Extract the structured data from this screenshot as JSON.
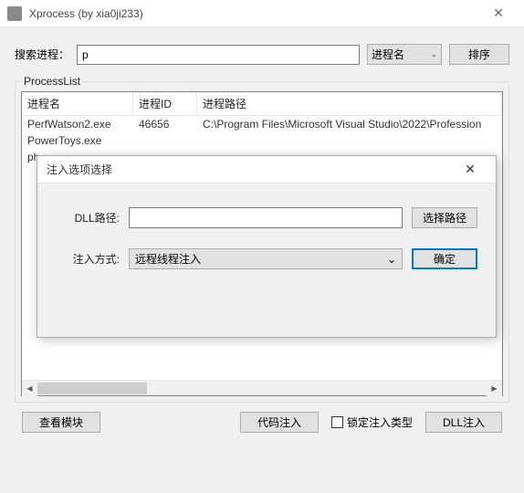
{
  "window": {
    "title": "Xprocess (by xia0ji233)",
    "close_glyph": "✕"
  },
  "search": {
    "label": "搜索进程：",
    "value": "p",
    "filter_label": "进程名",
    "sort_button": "排序"
  },
  "list": {
    "group_label": "ProcessList",
    "headers": {
      "name": "进程名",
      "id": "进程ID",
      "path": "进程路径"
    },
    "rows": [
      {
        "name": "PerfWatson2.exe",
        "id": "46656",
        "path": "C:\\Program Files\\Microsoft Visual Studio\\2022\\Profession"
      },
      {
        "name": "PowerToys.exe",
        "id": "",
        "path": ""
      },
      {
        "name": "ph",
        "id": "",
        "path": ""
      }
    ],
    "arrows": {
      "left": "◀",
      "right": "▶"
    }
  },
  "bottom": {
    "view_modules": "查看模块",
    "code_inject": "代码注入",
    "lock_type": "锁定注入类型",
    "dll_inject": "DLL注入"
  },
  "dialog": {
    "title": "注入选项选择",
    "close_glyph": "✕",
    "dll_label": "DLL路径:",
    "dll_value": "",
    "browse": "选择路径",
    "method_label": "注入方式:",
    "method_value": "远程线程注入",
    "confirm": "确定",
    "combo_arrow": "⌄"
  }
}
